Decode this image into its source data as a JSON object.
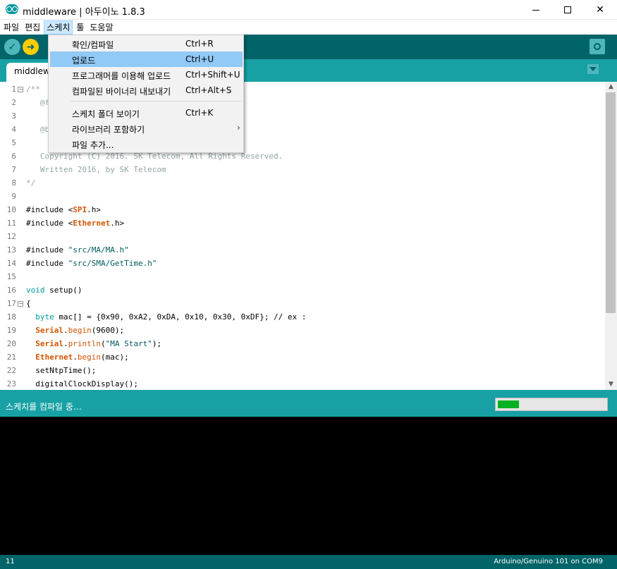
{
  "window": {
    "title": "middleware | 아두이노 1.8.3",
    "minimize_icon": "minimize-icon",
    "maximize_icon": "maximize-icon",
    "close_icon": "close-icon"
  },
  "menubar": {
    "items": [
      {
        "label": "파일"
      },
      {
        "label": "편집"
      },
      {
        "label": "스케치"
      },
      {
        "label": "툴"
      },
      {
        "label": "도움말"
      }
    ],
    "active": "스케치"
  },
  "toolbar": {
    "verify_icon": "checkmark-icon",
    "upload_icon": "arrow-right-icon",
    "serial_icon": "magnifier-icon"
  },
  "tab": {
    "label": "middlewa"
  },
  "sketch_menu": {
    "items": [
      {
        "label": "확인/컴파일",
        "shortcut": "Ctrl+R"
      },
      {
        "label": "업로드",
        "shortcut": "Ctrl+U"
      },
      {
        "label": "프로그래머를 이용해 업로드",
        "shortcut": "Ctrl+Shift+U"
      },
      {
        "label": "컴파일된 바이너리 내보내기",
        "shortcut": "Ctrl+Alt+S"
      },
      {
        "label": "스케치 폴더 보이기",
        "shortcut": "Ctrl+K"
      },
      {
        "label": "라이브러리 포함하기",
        "shortcut": "",
        "arrow": "›"
      },
      {
        "label": "파일 추가...",
        "shortcut": ""
      }
    ],
    "highlighted": "업로드"
  },
  "editor": {
    "lines": [
      {
        "n": "1",
        "parts": [
          {
            "t": "/**",
            "c": "cmt"
          }
        ]
      },
      {
        "n": "2",
        "parts": [
          {
            "t": "   @f",
            "c": "cmt"
          }
        ]
      },
      {
        "n": "3",
        "parts": []
      },
      {
        "n": "4",
        "parts": [
          {
            "t": "   @b",
            "c": "cmt"
          }
        ]
      },
      {
        "n": "5",
        "parts": []
      },
      {
        "n": "6",
        "parts": [
          {
            "t": "   Copyright (C) 2016. SK Telecom, All Rights Reserved.",
            "c": "cmt"
          }
        ]
      },
      {
        "n": "7",
        "parts": [
          {
            "t": "   Written 2016, by SK Telecom",
            "c": "cmt"
          }
        ]
      },
      {
        "n": "8",
        "parts": [
          {
            "t": "*/",
            "c": "cmt"
          }
        ]
      },
      {
        "n": "9",
        "parts": []
      },
      {
        "n": "10",
        "parts": [
          {
            "t": "#include <",
            "c": ""
          },
          {
            "t": "SPI",
            "c": "cls"
          },
          {
            "t": ".h>",
            "c": ""
          }
        ]
      },
      {
        "n": "11",
        "parts": [
          {
            "t": "#include <",
            "c": ""
          },
          {
            "t": "Ethernet",
            "c": "cls"
          },
          {
            "t": ".h>",
            "c": ""
          }
        ]
      },
      {
        "n": "12",
        "parts": []
      },
      {
        "n": "13",
        "parts": [
          {
            "t": "#include ",
            "c": ""
          },
          {
            "t": "\"src/MA/MA.h\"",
            "c": "str"
          }
        ]
      },
      {
        "n": "14",
        "parts": [
          {
            "t": "#include ",
            "c": ""
          },
          {
            "t": "\"src/SMA/GetTime.h\"",
            "c": "str"
          }
        ]
      },
      {
        "n": "15",
        "parts": []
      },
      {
        "n": "16",
        "parts": [
          {
            "t": "void",
            "c": "ty"
          },
          {
            "t": " setup()",
            "c": ""
          }
        ]
      },
      {
        "n": "17",
        "parts": [
          {
            "t": "{",
            "c": ""
          }
        ]
      },
      {
        "n": "18",
        "parts": [
          {
            "t": "  ",
            "c": ""
          },
          {
            "t": "byte",
            "c": "ty"
          },
          {
            "t": " mac[] = {0x90, 0xA2, 0xDA, 0x10, 0x30, 0xDF}; // ex :",
            "c": ""
          }
        ]
      },
      {
        "n": "19",
        "parts": [
          {
            "t": "  ",
            "c": ""
          },
          {
            "t": "Serial",
            "c": "cls"
          },
          {
            "t": ".",
            "c": ""
          },
          {
            "t": "begin",
            "c": "fn"
          },
          {
            "t": "(9600);",
            "c": ""
          }
        ]
      },
      {
        "n": "20",
        "parts": [
          {
            "t": "  ",
            "c": ""
          },
          {
            "t": "Serial",
            "c": "cls"
          },
          {
            "t": ".",
            "c": ""
          },
          {
            "t": "println",
            "c": "fn"
          },
          {
            "t": "(",
            "c": ""
          },
          {
            "t": "\"MA Start\"",
            "c": "str"
          },
          {
            "t": ");",
            "c": ""
          }
        ]
      },
      {
        "n": "21",
        "parts": [
          {
            "t": "  ",
            "c": ""
          },
          {
            "t": "Ethernet",
            "c": "cls"
          },
          {
            "t": ".",
            "c": ""
          },
          {
            "t": "begin",
            "c": "fn"
          },
          {
            "t": "(mac);",
            "c": ""
          }
        ]
      },
      {
        "n": "22",
        "parts": [
          {
            "t": "  setNtpTime();",
            "c": ""
          }
        ]
      },
      {
        "n": "23",
        "parts": [
          {
            "t": "  digitalClockDisplay();",
            "c": ""
          }
        ]
      }
    ],
    "fold_lines": [
      "1",
      "17"
    ],
    "fold_glyph": "−"
  },
  "scrollbar": {
    "up": "▲",
    "down": "▼"
  },
  "status": {
    "message": "스케치를 컴파일 중…",
    "progress": 0.2
  },
  "footer": {
    "line": "11",
    "board": "Arduino/Genuino 101 on COM9"
  },
  "colors": {
    "toolbar": "#006468",
    "accent": "#17a1a5",
    "upload_button": "#ffcc00",
    "menu_highlight": "#91c9f7",
    "progress": "#06b025"
  }
}
